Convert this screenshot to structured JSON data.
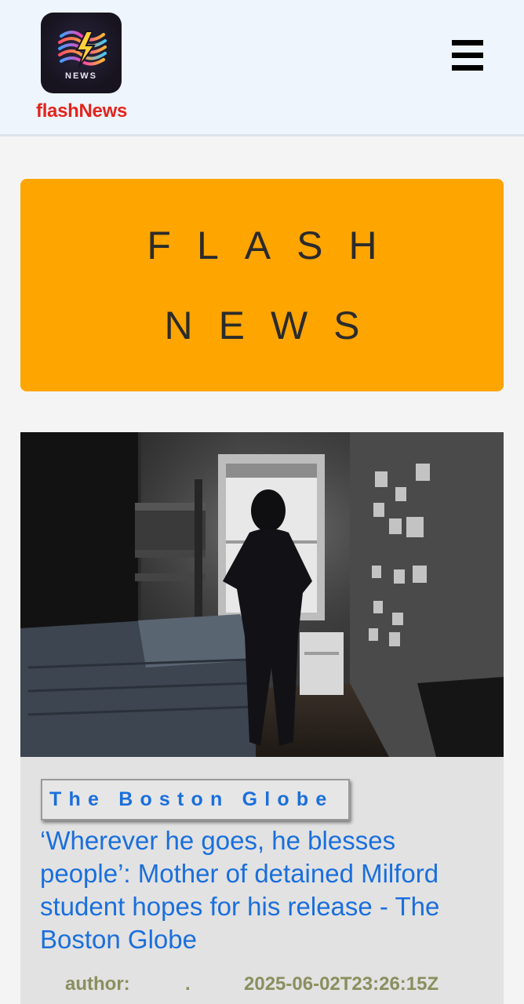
{
  "header": {
    "brand_name": "flashNews",
    "logo_text": "NEWS",
    "menu_icon": "hamburger-menu-icon"
  },
  "banner": {
    "line1": "FLASH",
    "line2": "NEWS"
  },
  "article": {
    "source": "The Boston Globe",
    "title": "‘Wherever he goes, he blesses people’: Mother of detained Milford student hopes for his release - The Boston Globe",
    "author_label": "author:",
    "author_value": ".",
    "published": "2025-06-02T23:26:15Z"
  },
  "colors": {
    "brand_red": "#e3241c",
    "banner_orange": "#ffa500",
    "link_blue": "#1a6fdc",
    "meta_olive": "#8a8f5e"
  }
}
